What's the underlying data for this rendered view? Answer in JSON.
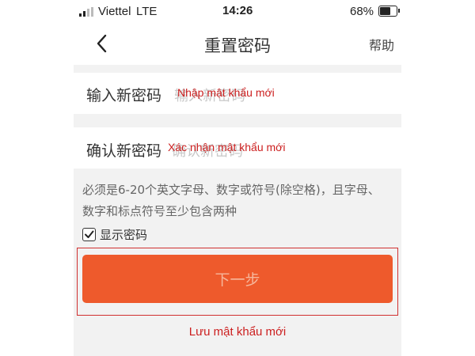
{
  "status_bar": {
    "carrier": "Viettel",
    "network": "LTE",
    "time": "14:26",
    "battery": "68%"
  },
  "nav": {
    "title": "重置密码",
    "help": "帮助"
  },
  "form": {
    "new_password_label": "输入新密码",
    "new_password_placeholder": "输入新密码",
    "new_password_annotation": "Nhập mật khẩu mới",
    "confirm_label": "确认新密码",
    "confirm_placeholder": "确认新密码",
    "confirm_annotation": "Xác nhận mật khẩu mới"
  },
  "hint": {
    "line1": "必须是6-20个英文字母、数字或符号(除空格)，且字母、",
    "line2": "数字和标点符号至少包含两种"
  },
  "show_password": {
    "label": "显示密码",
    "checked": true
  },
  "next_button": {
    "label": "下一步"
  },
  "save_annotation": "Lưu mật khẩu mới",
  "colors": {
    "accent": "#ee5a2c",
    "annotation": "#cc1f1f"
  }
}
